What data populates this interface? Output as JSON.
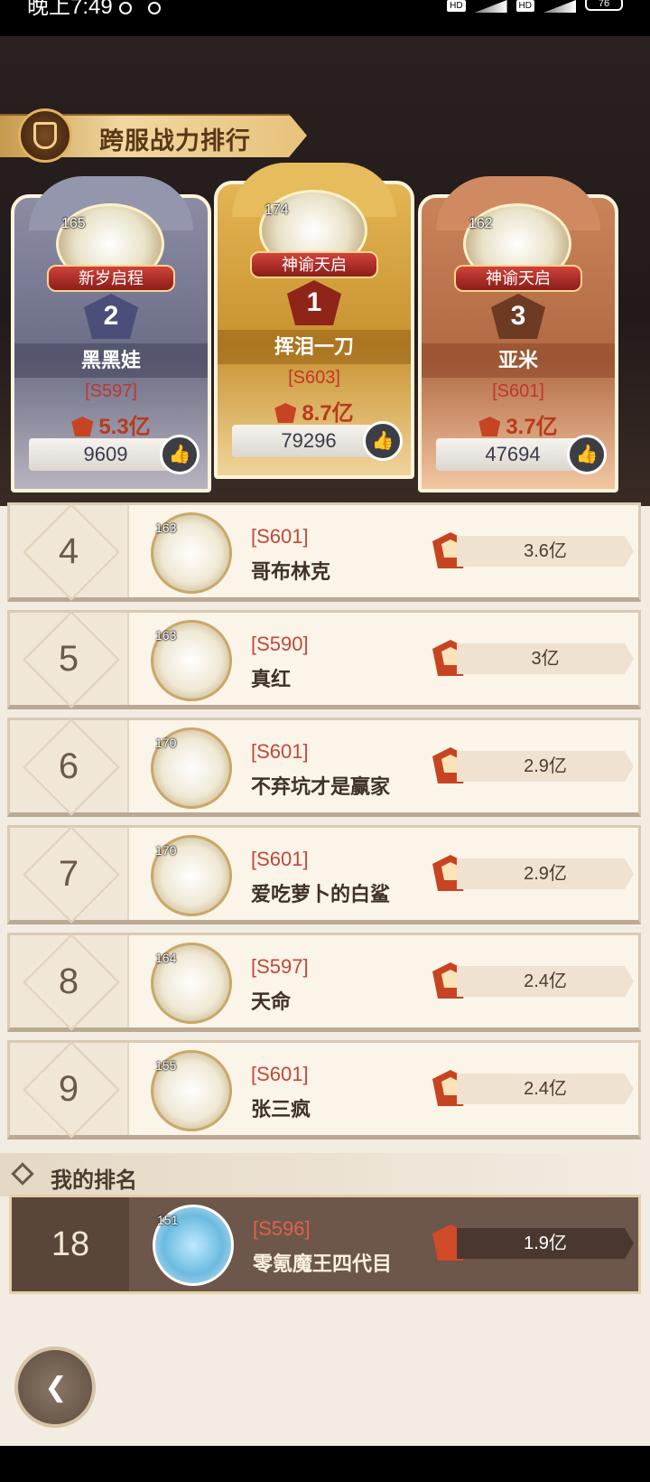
{
  "statusbar": {
    "time": "晚上7:49",
    "hd1": "HD",
    "hd2": "HD",
    "battery": "76"
  },
  "header": {
    "title": "跨服战力排行"
  },
  "podium": [
    {
      "rank": "2",
      "level": "165",
      "title_badge": "新岁启程",
      "name": "黑黑娃",
      "server": "[S597]",
      "power": "5.3亿",
      "likes": "9609"
    },
    {
      "rank": "1",
      "level": "174",
      "title_badge": "神谕天启",
      "name": "挥泪一刀",
      "server": "[S603]",
      "power": "8.7亿",
      "likes": "79296"
    },
    {
      "rank": "3",
      "level": "162",
      "title_badge": "神谕天启",
      "name": "亚米",
      "server": "[S601]",
      "power": "3.7亿",
      "likes": "47694"
    }
  ],
  "list": [
    {
      "rank": "4",
      "level": "163",
      "server": "[S601]",
      "name": "哥布林克",
      "power": "3.6亿"
    },
    {
      "rank": "5",
      "level": "163",
      "server": "[S590]",
      "name": "真红",
      "power": "3亿"
    },
    {
      "rank": "6",
      "level": "170",
      "server": "[S601]",
      "name": "不弃坑才是赢家",
      "power": "2.9亿"
    },
    {
      "rank": "7",
      "level": "170",
      "server": "[S601]",
      "name": "爱吃萝卜的白鲨",
      "power": "2.9亿"
    },
    {
      "rank": "8",
      "level": "164",
      "server": "[S597]",
      "name": "天命",
      "power": "2.4亿"
    },
    {
      "rank": "9",
      "level": "155",
      "server": "[S601]",
      "name": "张三疯",
      "power": "2.4亿"
    }
  ],
  "my_rank": {
    "label": "我的排名",
    "rank": "18",
    "level": "151",
    "server": "[S596]",
    "name": "零氪魔王四代目",
    "power": "1.9亿"
  },
  "icons": {
    "like": "thumbs-up-icon",
    "power": "power-crest-icon",
    "back": "back-arrow-icon"
  }
}
